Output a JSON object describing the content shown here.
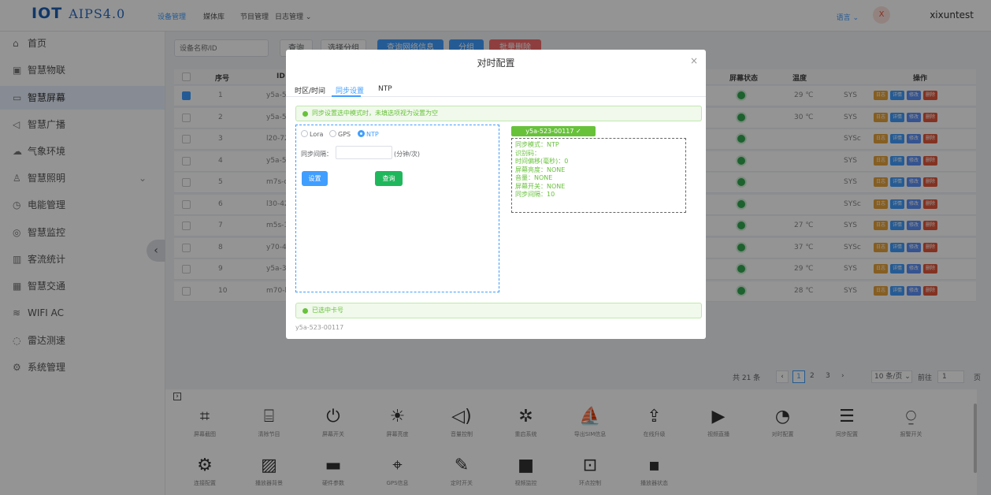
{
  "app": {
    "logo": "IOT",
    "version": "AIPS4.0",
    "nav": [
      "设备管理",
      "媒体库",
      "节目管理",
      "日志管理 ⌄"
    ],
    "lang": "语言 ⌄",
    "avatar": "X",
    "user": "xixuntest"
  },
  "sidebar": {
    "items": [
      {
        "icon": "⌂",
        "label": "首页"
      },
      {
        "icon": "▣",
        "label": "智慧物联"
      },
      {
        "icon": "▭",
        "label": "智慧屏幕"
      },
      {
        "icon": "◁",
        "label": "智慧广播"
      },
      {
        "icon": "☁",
        "label": "气象环境"
      },
      {
        "icon": "♙",
        "label": "智慧照明",
        "arrow": "⌄"
      },
      {
        "icon": "◷",
        "label": "电能管理"
      },
      {
        "icon": "◎",
        "label": "智慧监控"
      },
      {
        "icon": "▥",
        "label": "客流统计"
      },
      {
        "icon": "▦",
        "label": "智慧交通"
      },
      {
        "icon": "≋",
        "label": "WIFI AC"
      },
      {
        "icon": "◌",
        "label": "雷达测速"
      },
      {
        "icon": "⚙",
        "label": "系统管理"
      }
    ],
    "collapse": "‹"
  },
  "toolbar": {
    "search_placeholder": "设备名称/ID",
    "query": "查询",
    "choose_group": "选择分组",
    "net_info": "查询网络信息",
    "group": "分组",
    "batch_delete": "批量删除"
  },
  "table": {
    "headers": {
      "index": "序号",
      "id": "ID",
      "screen_state": "屏幕状态",
      "temp": "温度",
      "ops": "操作"
    },
    "rows": [
      {
        "n": "1",
        "id": "y5a-523-0",
        "temp": "29 ℃",
        "sys": "SYS",
        "checked": true
      },
      {
        "n": "2",
        "id": "y5a-523-0",
        "temp": "30 ℃",
        "sys": "SYS"
      },
      {
        "n": "3",
        "id": "l20-721-2",
        "temp": "",
        "sys": "SYSc"
      },
      {
        "n": "4",
        "id": "y5a-523-0",
        "temp": "",
        "sys": "SYS"
      },
      {
        "n": "5",
        "id": "m7s-c22-0",
        "temp": "",
        "sys": "SYS"
      },
      {
        "n": "6",
        "id": "l30-423-0",
        "temp": "",
        "sys": "SYSc"
      },
      {
        "n": "7",
        "id": "m5s-123-0",
        "temp": "27 ℃",
        "sys": "SYS"
      },
      {
        "n": "8",
        "id": "y70-421-0",
        "temp": "37 ℃",
        "sys": "SYSc"
      },
      {
        "n": "9",
        "id": "y5a-323-0",
        "temp": "29 ℃",
        "sys": "SYS"
      },
      {
        "n": "10",
        "id": "m70-b21-0",
        "temp": "28 ℃",
        "sys": "SYS"
      }
    ],
    "op_labels": [
      "日志",
      "详情",
      "修改",
      "删除"
    ]
  },
  "pager": {
    "total": "共 21 条",
    "p1": "1",
    "p2": "2",
    "p3": "3",
    "next": "›",
    "size": "10 条/页 ⌄",
    "goto": "前往",
    "page": "1",
    "unit": "页"
  },
  "panel": {
    "items": [
      {
        "icon": "⌗",
        "label": "屏幕截图"
      },
      {
        "icon": "⌸",
        "label": "清除节目"
      },
      {
        "icon": "⏻",
        "label": "屏幕开关"
      },
      {
        "icon": "☀",
        "label": "屏幕亮度"
      },
      {
        "icon": "◁)",
        "label": "音量控制"
      },
      {
        "icon": "✲",
        "label": "重启系统"
      },
      {
        "icon": "⛵",
        "label": "导出SIM信息"
      },
      {
        "icon": "⇪",
        "label": "在线升级"
      },
      {
        "icon": "▶",
        "label": "视频直播"
      },
      {
        "icon": "◔",
        "label": "对时配置"
      },
      {
        "icon": "☰",
        "label": "同步配置"
      },
      {
        "icon": "⍜",
        "label": "报警开关"
      },
      {
        "icon": "⚙",
        "label": "连接配置"
      },
      {
        "icon": "▨",
        "label": "播放器背景"
      },
      {
        "icon": "▬",
        "label": "硬件参数"
      },
      {
        "icon": "⌖",
        "label": "GPS信息"
      },
      {
        "icon": "✎",
        "label": "定时开关"
      },
      {
        "icon": "■",
        "label": "视频监控"
      },
      {
        "icon": "⊡",
        "label": "环点控制"
      },
      {
        "icon": "▪",
        "label": "播放器状态"
      }
    ]
  },
  "dialog": {
    "title": "对时配置",
    "close": "×",
    "tabs": [
      "时区/时间",
      "同步设置",
      "NTP"
    ],
    "alert": "同步设置选中模式时，未填选项视为设置为空",
    "radios": [
      "Lora",
      "GPS",
      "NTP"
    ],
    "interval_label": "同步间隔：",
    "interval_unit": "(分钟/次)",
    "interval_value": "",
    "set_btn": "设置",
    "query_btn": "查询",
    "tag": "y5a-523-00117 ✓",
    "info": [
      "同步模式：NTP",
      "识别码：",
      "时间偏移(毫秒)：0",
      "屏幕亮度：NONE",
      "音量：NONE",
      "屏幕开关：NONE",
      "同步间隔：10"
    ],
    "selected_title": "已选中卡号",
    "selected_card": "y5a-523-00117"
  },
  "colors": {
    "primary": "#409eff",
    "success": "#67c23a",
    "danger": "#e2573c",
    "orange": "#e6a23c"
  }
}
